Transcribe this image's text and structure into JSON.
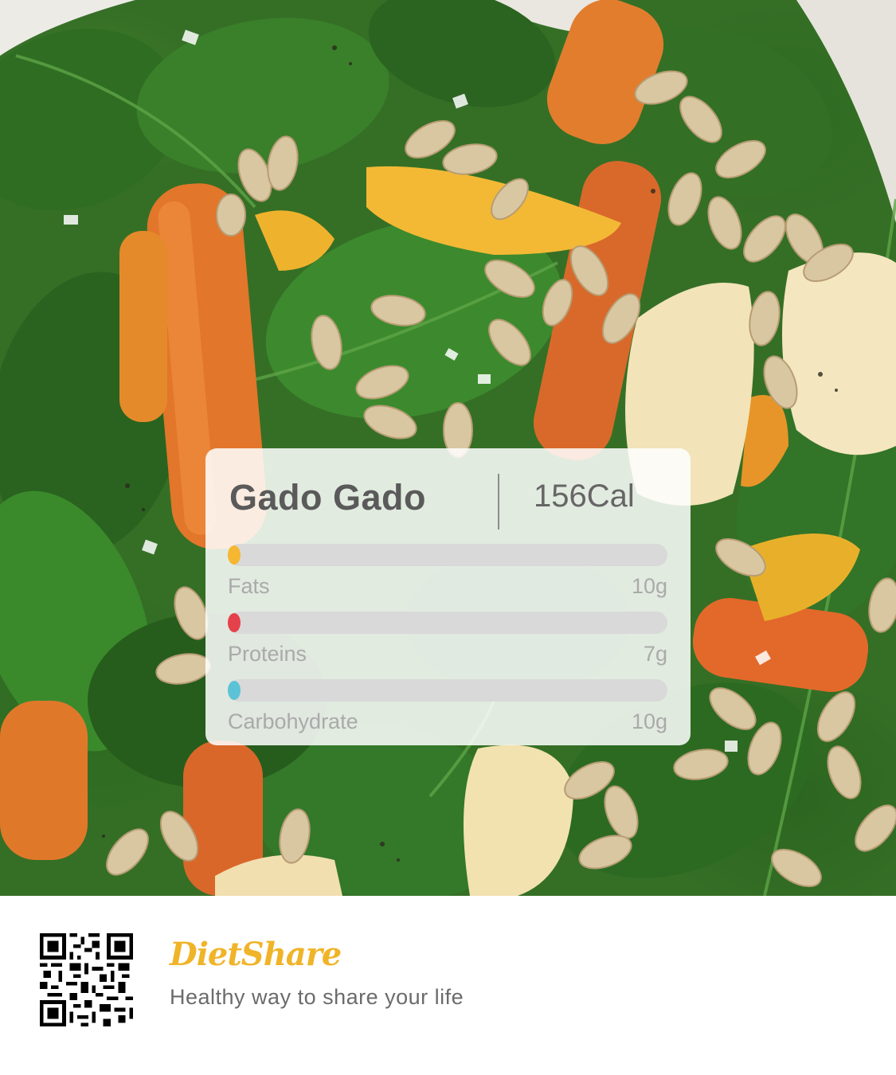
{
  "dish": {
    "name": "Gado Gado",
    "calories": "156Cal"
  },
  "nutrients": [
    {
      "label": "Fats",
      "value": "10g",
      "color": "#f5b731",
      "level": 0.02
    },
    {
      "label": "Proteins",
      "value": "7g",
      "color": "#e5414b",
      "level": 0.02
    },
    {
      "label": "Carbohydrate",
      "value": "10g",
      "color": "#5cc3d6",
      "level": 0.02
    }
  ],
  "footer": {
    "brand": "DietShare",
    "tagline": "Healthy way to share your life",
    "qr_icon": "qr-code-icon"
  },
  "colors": {
    "brand": "#f0b429",
    "text_dark": "#5a5a5a",
    "text_muted": "#aaaaaa",
    "bar_track": "#d9d9d9"
  }
}
